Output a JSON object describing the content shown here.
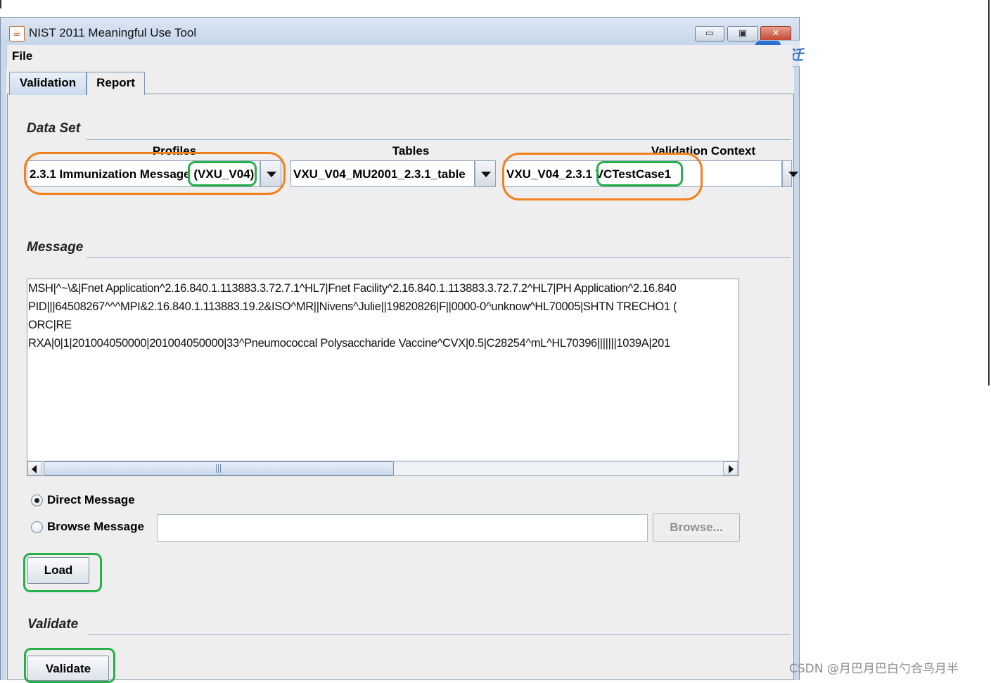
{
  "window": {
    "title": "NIST 2011 Meaningful Use Tool",
    "buttons": {
      "minimize": "▭",
      "maximize": "▣",
      "close": "✕"
    }
  },
  "sidetab": {
    "icon": "bird-icon",
    "glyph": "迁"
  },
  "menu": {
    "file": "File"
  },
  "tabs": [
    {
      "label": "Validation",
      "active": true
    },
    {
      "label": "Report",
      "active": false
    }
  ],
  "dataset": {
    "title": "Data Set",
    "profiles": {
      "label": "Profiles",
      "value": "2.3.1 Immunization Message (VXU_V04)"
    },
    "tables": {
      "label": "Tables",
      "value": "VXU_V04_MU2001_2.3.1_table"
    },
    "context": {
      "label": "Validation Context",
      "value": "VXU_V04_2.3.1 VCTestCase1"
    }
  },
  "message": {
    "title": "Message",
    "lines": [
      "MSH|^~\\&|Fnet Application^2.16.840.1.113883.3.72.7.1^HL7|Fnet Facility^2.16.840.1.113883.3.72.7.2^HL7|PH Application^2.16.840",
      "PID|||64508267^^^MPI&2.16.840.1.113883.19.2&ISO^MR||Nivens^Julie||19820826|F||0000-0^unknow^HL70005|SHTN TRECHO1 (",
      "ORC|RE",
      "RXA|0|1|201004050000|201004050000|33^Pneumococcal Polysaccharide Vaccine^CVX|0.5|C28254^mL^HL70396|||||||1039A|201"
    ],
    "source": {
      "direct_label": "Direct Message",
      "browse_label": "Browse Message",
      "selected": "direct",
      "browse_path": "",
      "browse_button": "Browse..."
    },
    "load_button": "Load"
  },
  "validate": {
    "title": "Validate",
    "button": "Validate"
  },
  "watermark": "CSDN @月巴月巴白勺合鸟月半",
  "colors": {
    "highlight_orange": "#f2801c",
    "highlight_green": "#26b04a",
    "accent": "#7f97b4"
  }
}
